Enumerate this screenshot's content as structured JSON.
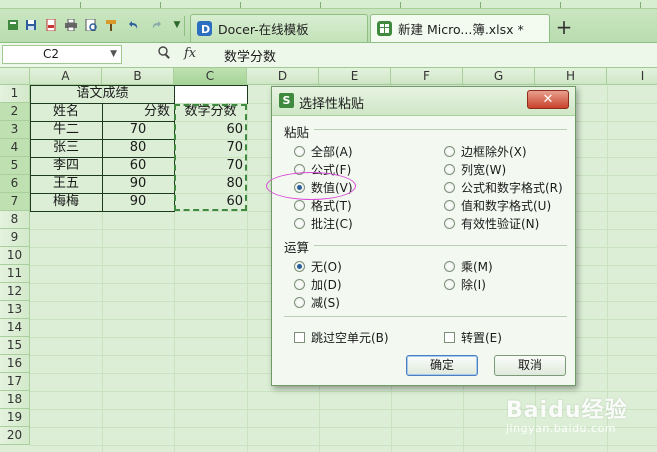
{
  "tabs": [
    {
      "label": "Docer-在线模板",
      "icon": "docer-icon",
      "active": false
    },
    {
      "label": "新建 Micro...簿.xlsx *",
      "icon": "spreadsheet-icon",
      "active": true
    }
  ],
  "formula_bar": {
    "name_box": "C2",
    "fx": "fx",
    "content": "数学分数"
  },
  "columns": [
    "A",
    "B",
    "C",
    "D",
    "E",
    "F",
    "G",
    "H",
    "I"
  ],
  "rows": [
    "1",
    "2",
    "3",
    "4",
    "5",
    "6",
    "7",
    "8",
    "9",
    "10",
    "11",
    "12",
    "13",
    "14",
    "15",
    "16",
    "17",
    "18",
    "19",
    "20"
  ],
  "sheet": {
    "title": "语文成绩",
    "headers": [
      "姓名",
      "分数",
      "数学分数"
    ],
    "records": [
      {
        "name": "牛二",
        "score": "70",
        "math": "60"
      },
      {
        "name": "张三",
        "score": "80",
        "math": "70"
      },
      {
        "name": "李四",
        "score": "60",
        "math": "70"
      },
      {
        "name": "王五",
        "score": "90",
        "math": "80"
      },
      {
        "name": "梅梅",
        "score": "90",
        "math": "60"
      }
    ]
  },
  "dialog": {
    "title": "选择性粘贴",
    "logo": "S",
    "close_label": "✕",
    "paste_section": "粘贴",
    "paste_left": [
      "全部(A)",
      "公式(F)",
      "数值(V)",
      "格式(T)",
      "批注(C)"
    ],
    "paste_right": [
      "边框除外(X)",
      "列宽(W)",
      "公式和数字格式(R)",
      "值和数字格式(U)",
      "有效性验证(N)"
    ],
    "paste_selected": "数值(V)",
    "op_section": "运算",
    "op_left": [
      "无(O)",
      "加(D)",
      "减(S)"
    ],
    "op_right": [
      "乘(M)",
      "除(I)"
    ],
    "op_selected": "无(O)",
    "skip_blanks": "跳过空单元(B)",
    "transpose": "转置(E)",
    "ok": "确定",
    "cancel": "取消"
  },
  "watermark": {
    "main": "Baidu经验",
    "sub": "jingyan.baidu.com"
  },
  "colors": {
    "theme_green": "#b9dcaf",
    "accent": "#3f8a3f",
    "highlight_ellipse": "#d84bd8",
    "close_red": "#c9432a"
  }
}
